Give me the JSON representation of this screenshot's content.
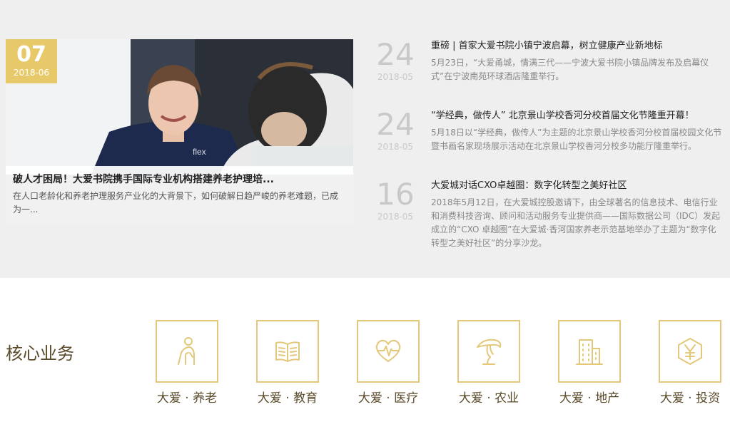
{
  "feature": {
    "day": "07",
    "month": "2018-06",
    "title": "破人才困局！大爱书院携手国际专业机构搭建养老护理培...",
    "desc": "在人口老龄化和养老护理服务产业化的大背景下，如何破解日趋严峻的养老难题，已成为一...",
    "photo_text": "flex"
  },
  "news": [
    {
      "day": "24",
      "month": "2018-05",
      "title": "重磅 | 首家大爱书院小镇宁波启幕，树立健康产业新地标",
      "desc": "5月23日，“大爱甬城，情满三代——宁波大爱书院小镇品牌发布及启幕仪式”在宁波南苑环球酒店隆重举行。"
    },
    {
      "day": "24",
      "month": "2018-05",
      "title": "“学经典，做传人” 北京景山学校香河分校首届文化节隆重开幕！",
      "desc": "5月18日以“学经典，做传人”为主题的北京景山学校香河分校首届校园文化节暨书画名家现场展示活动在北京景山学校香河分校多功能厅隆重举行。"
    },
    {
      "day": "16",
      "month": "2018-05",
      "title": "大爱城对话CXO卓越圈：数字化转型之美好社区",
      "desc": "2018年5月12日，在大爱城控股邀请下，由全球著名的信息技术、电信行业和消费科技咨询、顾问和活动服务专业提供商——国际数据公司（IDC）发起成立的“CXO 卓越圈”在大爱城·香河国家养老示范基地举办了主题为“数字化转型之美好社区”的分享沙龙。"
    }
  ],
  "core": {
    "title": "核心业务",
    "items": [
      {
        "label": "大爱 · 养老",
        "icon": "elderly-icon"
      },
      {
        "label": "大爱 · 教育",
        "icon": "book-icon"
      },
      {
        "label": "大爱 · 医疗",
        "icon": "heart-pulse-icon"
      },
      {
        "label": "大爱 · 农业",
        "icon": "mushroom-icon"
      },
      {
        "label": "大爱 · 地产",
        "icon": "building-icon"
      },
      {
        "label": "大爱 · 投资",
        "icon": "yen-hexagon-icon"
      }
    ]
  },
  "colors": {
    "accent_gold": "#e8c96a",
    "icon_gold": "#e3c77a",
    "section_bg": "#efefef",
    "date_gray": "#c9c9c9",
    "title_brown": "#5a4a2a"
  }
}
